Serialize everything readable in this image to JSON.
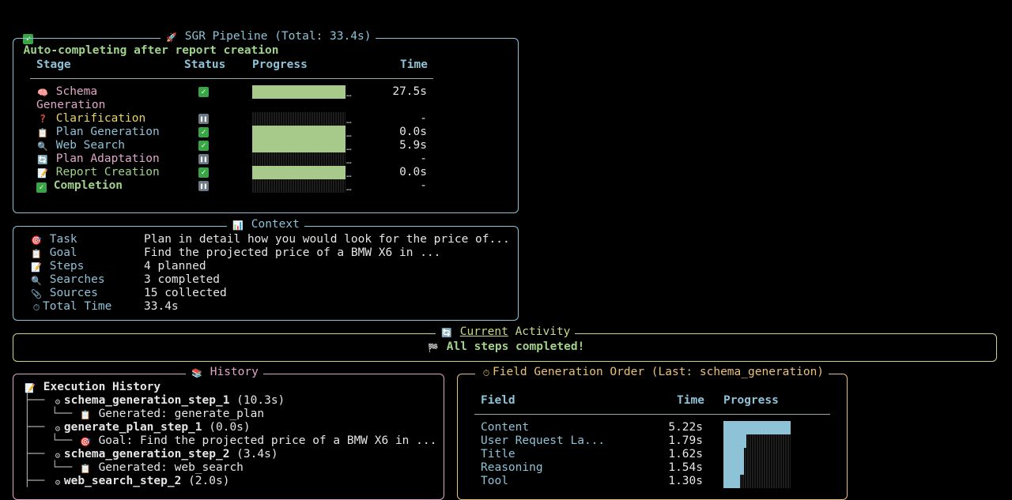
{
  "status_line": "Auto-completing after report creation",
  "pipeline": {
    "title": "SGR Pipeline (Total: 33.4s)",
    "headers": {
      "stage": "Stage",
      "status": "Status",
      "progress": "Progress",
      "time": "Time"
    },
    "stages": [
      {
        "line1": "Schema",
        "line2": "Generation",
        "icon": "brain-icon",
        "status": "done",
        "progress": 1.0,
        "time": "27.5s",
        "color": "#e0a6c8"
      },
      {
        "line1": "Clarification",
        "icon": "question-icon",
        "status": "paused",
        "progress": 0.0,
        "time": "-",
        "color": "#e8d46a"
      },
      {
        "line1": "Plan Generation",
        "icon": "clipboard-icon",
        "status": "done",
        "progress": 1.0,
        "time": "0.0s",
        "color": "#8ec2d6"
      },
      {
        "line1": "Web Search",
        "icon": "magnifier-icon",
        "status": "done",
        "progress": 1.0,
        "time": "5.9s",
        "color": "#8ec2d6"
      },
      {
        "line1": "Plan Adaptation",
        "icon": "refresh-icon",
        "status": "paused",
        "progress": 0.0,
        "time": "-",
        "color": "#e0a6c8"
      },
      {
        "line1": "Report Creation",
        "icon": "memo-icon",
        "status": "done",
        "progress": 1.0,
        "time": "0.0s",
        "color": "#9fd38a"
      },
      {
        "line1": "Completion",
        "icon": "check-icon",
        "status": "paused",
        "progress": 0.0,
        "time": "-",
        "color": "#9fd38a"
      }
    ]
  },
  "context": {
    "title": "Context",
    "rows": [
      {
        "icon": "target-icon",
        "label": "Task",
        "value": "Plan in detail how you would look for the price of..."
      },
      {
        "icon": "clipboard-icon",
        "label": "Goal",
        "value": "Find the projected price of a BMW X6 in ..."
      },
      {
        "icon": "memo-icon",
        "label": "Steps",
        "value": "4 planned"
      },
      {
        "icon": "magnifier-icon",
        "label": "Searches",
        "value": "3 completed"
      },
      {
        "icon": "paperclip-icon",
        "label": "Sources",
        "value": "15 collected"
      },
      {
        "icon": "stopwatch-icon",
        "label": "Total Time",
        "value": "33.4s"
      }
    ]
  },
  "activity": {
    "title_underlined": "Current",
    "title_rest": "Activity",
    "message": "All steps completed!"
  },
  "history": {
    "title": "History",
    "root": "Execution History",
    "items": [
      {
        "name": "schema_generation_step_1",
        "time": "(10.3s)",
        "child_icon": "clipboard-icon",
        "child": "Generated: generate_plan"
      },
      {
        "name": "generate_plan_step_1",
        "time": "(0.0s)",
        "child_icon": "target-icon",
        "child": "Goal: Find the projected price of a BMW X6 in ..."
      },
      {
        "name": "schema_generation_step_2",
        "time": "(3.4s)",
        "child_icon": "clipboard-icon",
        "child": "Generated: web_search"
      },
      {
        "name": "web_search_step_2",
        "time": "(2.0s)",
        "child_icon": "",
        "child": ""
      }
    ]
  },
  "field_order": {
    "title": "Field Generation Order (Last: schema_generation)",
    "headers": {
      "field": "Field",
      "time": "Time",
      "progress": "Progress"
    },
    "rows": [
      {
        "field": "Content",
        "time": "5.22s",
        "progress": 1.0
      },
      {
        "field": "User Request La...",
        "time": "1.79s",
        "progress": 0.34
      },
      {
        "field": "Title",
        "time": "1.62s",
        "progress": 0.31
      },
      {
        "field": "Reasoning",
        "time": "1.54s",
        "progress": 0.3
      },
      {
        "field": "Tool",
        "time": "1.30s",
        "progress": 0.25
      }
    ]
  },
  "colors": {
    "border_cyan": "#8ec2d6",
    "border_green": "#c9d98a",
    "border_pink": "#e0a6c8",
    "border_orange": "#e8c27a",
    "bar_green": "#a7c98a",
    "bar_blue": "#8ec2d6"
  }
}
